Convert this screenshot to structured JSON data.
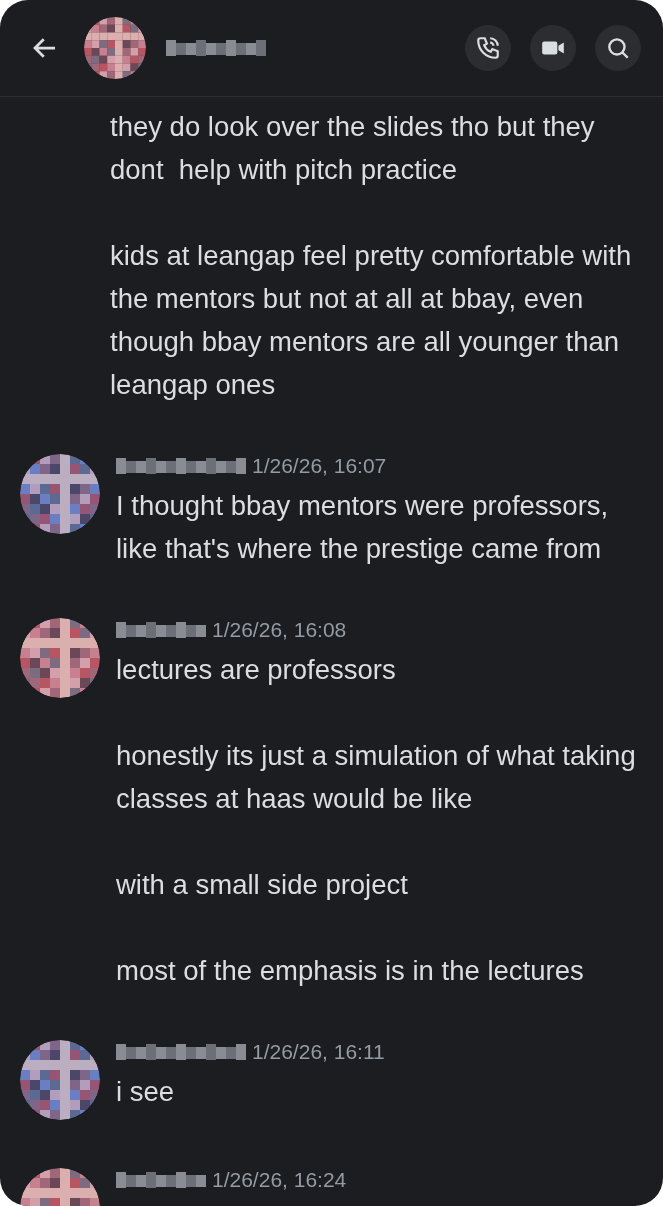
{
  "messages": [
    {
      "kind": "continuation",
      "paragraphs": [
        "they do look over the slides tho but they dont  help with pitch practice",
        "kids at leangap feel pretty comfortable with the mentors but not at all at bbay, even though bbay mentors are all younger than leangap ones"
      ]
    },
    {
      "kind": "message",
      "timestamp": "1/26/26, 16:07",
      "paragraphs": [
        "I thought bbay mentors were professors, like that's where the prestige came from"
      ]
    },
    {
      "kind": "message",
      "timestamp": "1/26/26, 16:08",
      "paragraphs": [
        "lectures are professors",
        "honestly its just a simulation of what taking classes at haas would be like",
        "with a small side project",
        "most of the emphasis is in the lectures"
      ]
    },
    {
      "kind": "message",
      "timestamp": "1/26/26, 16:11",
      "paragraphs": [
        "i see"
      ]
    },
    {
      "kind": "message",
      "timestamp": "1/26/26, 16:24"
    }
  ]
}
